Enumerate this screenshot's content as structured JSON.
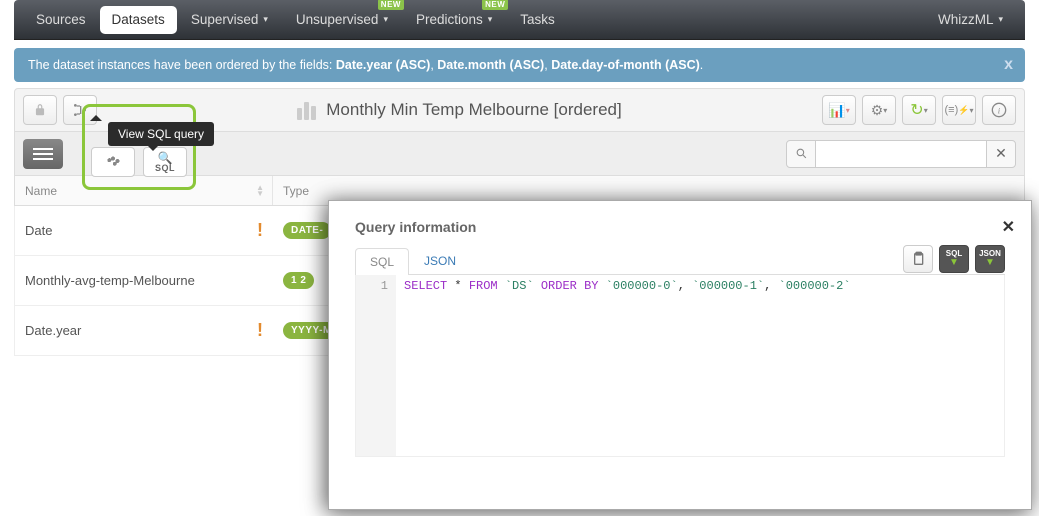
{
  "nav": {
    "sources": "Sources",
    "datasets": "Datasets",
    "supervised": "Supervised",
    "unsupervised": "Unsupervised",
    "predictions": "Predictions",
    "tasks": "Tasks",
    "whizzml": "WhizzML",
    "new_badge": "NEW"
  },
  "info_bar": {
    "prefix": "The dataset instances have been ordered by the fields: ",
    "f1": "Date.year (ASC)",
    "f2": "Date.month (ASC)",
    "f3": "Date.day-of-month (ASC)",
    "sep": ", ",
    "period": "."
  },
  "title": "Monthly Min Temp Melbourne [ordered]",
  "tooltip": "View SQL query",
  "search": {
    "placeholder": ""
  },
  "table": {
    "headers": {
      "name": "Name",
      "type": "Type"
    },
    "rows": [
      {
        "name": "Date",
        "warn": true,
        "badge": "DATE-"
      },
      {
        "name": "Monthly-avg-temp-Melbourne",
        "warn": false,
        "badge": "1 2"
      },
      {
        "name": "Date.year",
        "warn": true,
        "badge": "YYYY-M"
      }
    ]
  },
  "modal": {
    "title": "Query information",
    "tabs": {
      "sql": "SQL",
      "json": "JSON"
    },
    "actions": {
      "sql": "SQL",
      "json": "JSON"
    },
    "line_no": "1",
    "code": {
      "select": "SELECT",
      "star": " * ",
      "from": "FROM",
      "ds": " `DS` ",
      "orderby": "ORDER BY",
      "c1": " `000000-0`",
      "comma1": ", ",
      "c2": "`000000-1`",
      "comma2": ", ",
      "c3": "`000000-2`"
    }
  }
}
